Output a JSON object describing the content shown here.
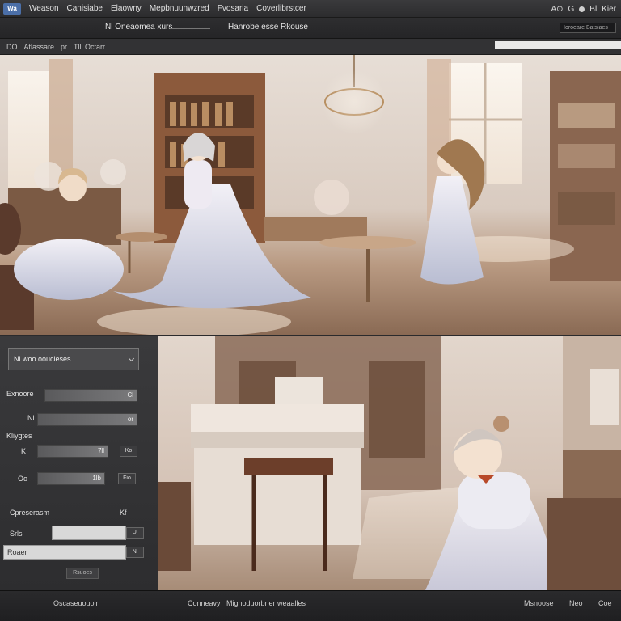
{
  "menubar": {
    "logo": "Wa",
    "items": [
      "Weason",
      "Canisiabe",
      "Elaowny",
      "Mepbnuunwzred",
      "Fvosaria",
      "Coverlibrstcer"
    ],
    "right": {
      "a": "A⊙",
      "b": "G",
      "c": "Bl",
      "d": "Kier"
    }
  },
  "toolbar": {
    "tab_a": "Nl Oneaomea xurs",
    "tab_b": "Hanrobe esse Rkouse",
    "field": "Ioroeare Batsiaes"
  },
  "breadcrumb": {
    "a": "DO",
    "b": "Atlassare",
    "c": "pr",
    "d": "Tlli Octarr"
  },
  "panel": {
    "header": "Ni woo ooucieses",
    "rows": [
      {
        "label": "Exnoore",
        "value": "Cl"
      },
      {
        "label": "Nl",
        "value": "or"
      },
      {
        "label": "Kliygtes",
        "value": ""
      },
      {
        "label": "K",
        "value": "7ll",
        "box": "Ko"
      },
      {
        "label": "Oo",
        "value": "1lb",
        "box": "Fio"
      }
    ],
    "section": "Cpreserasm",
    "section_badge": "Kf",
    "input1_label": "Srls",
    "input1_box": "Ul",
    "input2_value": "Roaer",
    "input2_box": "Nl",
    "button1": "Rsuoes",
    "button2": "Oscaseuouoin"
  },
  "status": {
    "left_a": "Conneavy",
    "left_b": "Mighoduorbner weaalles",
    "right_a": "Msnoose",
    "right_b": "Neo",
    "right_c": "Coe"
  },
  "colors": {
    "panel_bg": "#3a3a3c",
    "accent": "#4b6fa8"
  }
}
